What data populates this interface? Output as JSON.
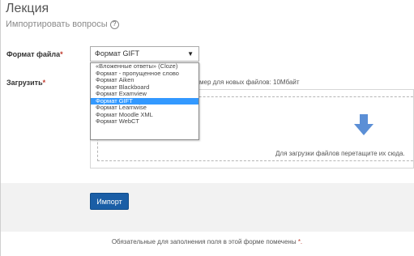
{
  "page": {
    "title": "Лекция"
  },
  "import_questions": {
    "label": "Импортировать вопросы",
    "help_icon": "help-icon"
  },
  "format": {
    "label": "Формат файла",
    "required_mark": "*",
    "selected_value": "Формат GIFT",
    "options": [
      "«Вложенные ответы» (Cloze)",
      "Формат - пропущенное слово",
      "Формат Aiken",
      "Формат Blackboard",
      "Формат Examview",
      "Формат GIFT",
      "Формат Learnwise",
      "Формат Moodle XML",
      "Формат WebCT"
    ],
    "highlighted_index": 5
  },
  "upload": {
    "label": "Загрузить",
    "required_mark": "*",
    "max_size_text": "мер для новых файлов: 10Мбайт",
    "drop_text": "Для загрузки файлов перетащите их сюда.",
    "arrow_color": "#5b8fd6"
  },
  "import_button": {
    "label": "Импорт",
    "color": "#1a5ea6"
  },
  "footer": {
    "note": "Обязательные для заполнения поля в этой форме помечены",
    "required_mark": "*."
  }
}
